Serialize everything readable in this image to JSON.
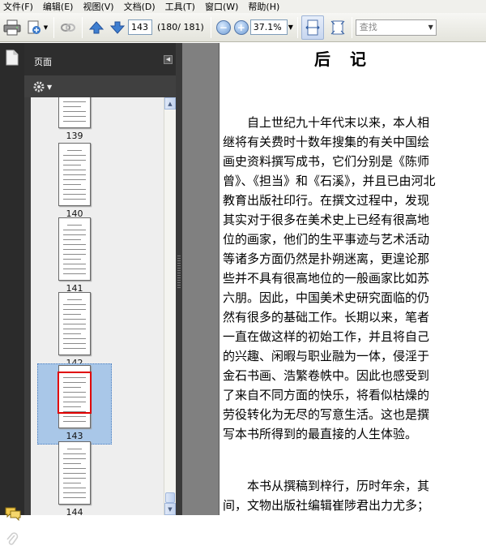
{
  "menu": {
    "items": [
      {
        "label": "文件(F)"
      },
      {
        "label": "编辑(E)"
      },
      {
        "label": "视图(V)"
      },
      {
        "label": "文档(D)"
      },
      {
        "label": "工具(T)"
      },
      {
        "label": "窗口(W)"
      },
      {
        "label": "帮助(H)"
      }
    ]
  },
  "toolbar": {
    "current_page": "143",
    "page_count": "(180/ 181)",
    "zoom": "37.1%",
    "search_placeholder": "查找"
  },
  "icons": {
    "print": "printer-icon",
    "share": "share-icon",
    "link": "link-icon",
    "prev": "prev-page-arrow-icon",
    "next": "next-page-arrow-icon",
    "zoom_out": "zoom-out-icon",
    "zoom_in": "zoom-in-icon",
    "fit_width": "fit-width-icon",
    "fit_page": "fit-page-icon",
    "pages_panel": "pages-icon",
    "comments": "comments-icon",
    "attachments": "paperclip-icon",
    "options": "gear-icon"
  },
  "panel": {
    "title": "页面",
    "thumbnails": [
      {
        "label": "139",
        "selected": false
      },
      {
        "label": "140",
        "selected": false
      },
      {
        "label": "141",
        "selected": false
      },
      {
        "label": "142",
        "selected": false
      },
      {
        "label": "143",
        "selected": true
      },
      {
        "label": "144",
        "selected": false
      }
    ]
  },
  "document": {
    "title": "后　记",
    "paragraph1": [
      "　　自上世纪九十年代末以来，本人相",
      "继将有关费时十数年搜集的有关中国绘",
      "画史资料撰写成书，它们分别是《陈师",
      "曾》、《担当》和《石溪》，并且已由河北",
      "教育出版社印行。在撰文过程中，发现",
      "其实对于很多在美术史上已经有很高地",
      "位的画家，他们的生平事迹与艺术活动",
      "等诸多方面仍然是扑朔迷离，更遑论那",
      "些并不具有很高地位的一般画家比如苏",
      "六朋。因此，中国美术史研究面临的仍",
      "然有很多的基础工作。长期以来，笔者",
      "一直在做这样的初始工作，并且将自己",
      "的兴趣、闲暇与职业融为一体，侵淫于",
      "金石书画、浩繁卷帙中。因此也感受到",
      "了来自不同方面的快乐，将看似枯燥的",
      "劳役转化为无尽的写意生活。这也是撰",
      "写本书所得到的最直接的人生体验。"
    ],
    "paragraph2": [
      "　　本书从撰稿到梓行，历时年余，其",
      "间，文物出版社编辑崔陟君出力尤多；"
    ]
  },
  "colors": {
    "panel_dark": "#2e2e2e",
    "selected_thumb_bg": "#a9c7e8",
    "thumb_highlight": "#e00000",
    "doc_background": "#808080"
  }
}
